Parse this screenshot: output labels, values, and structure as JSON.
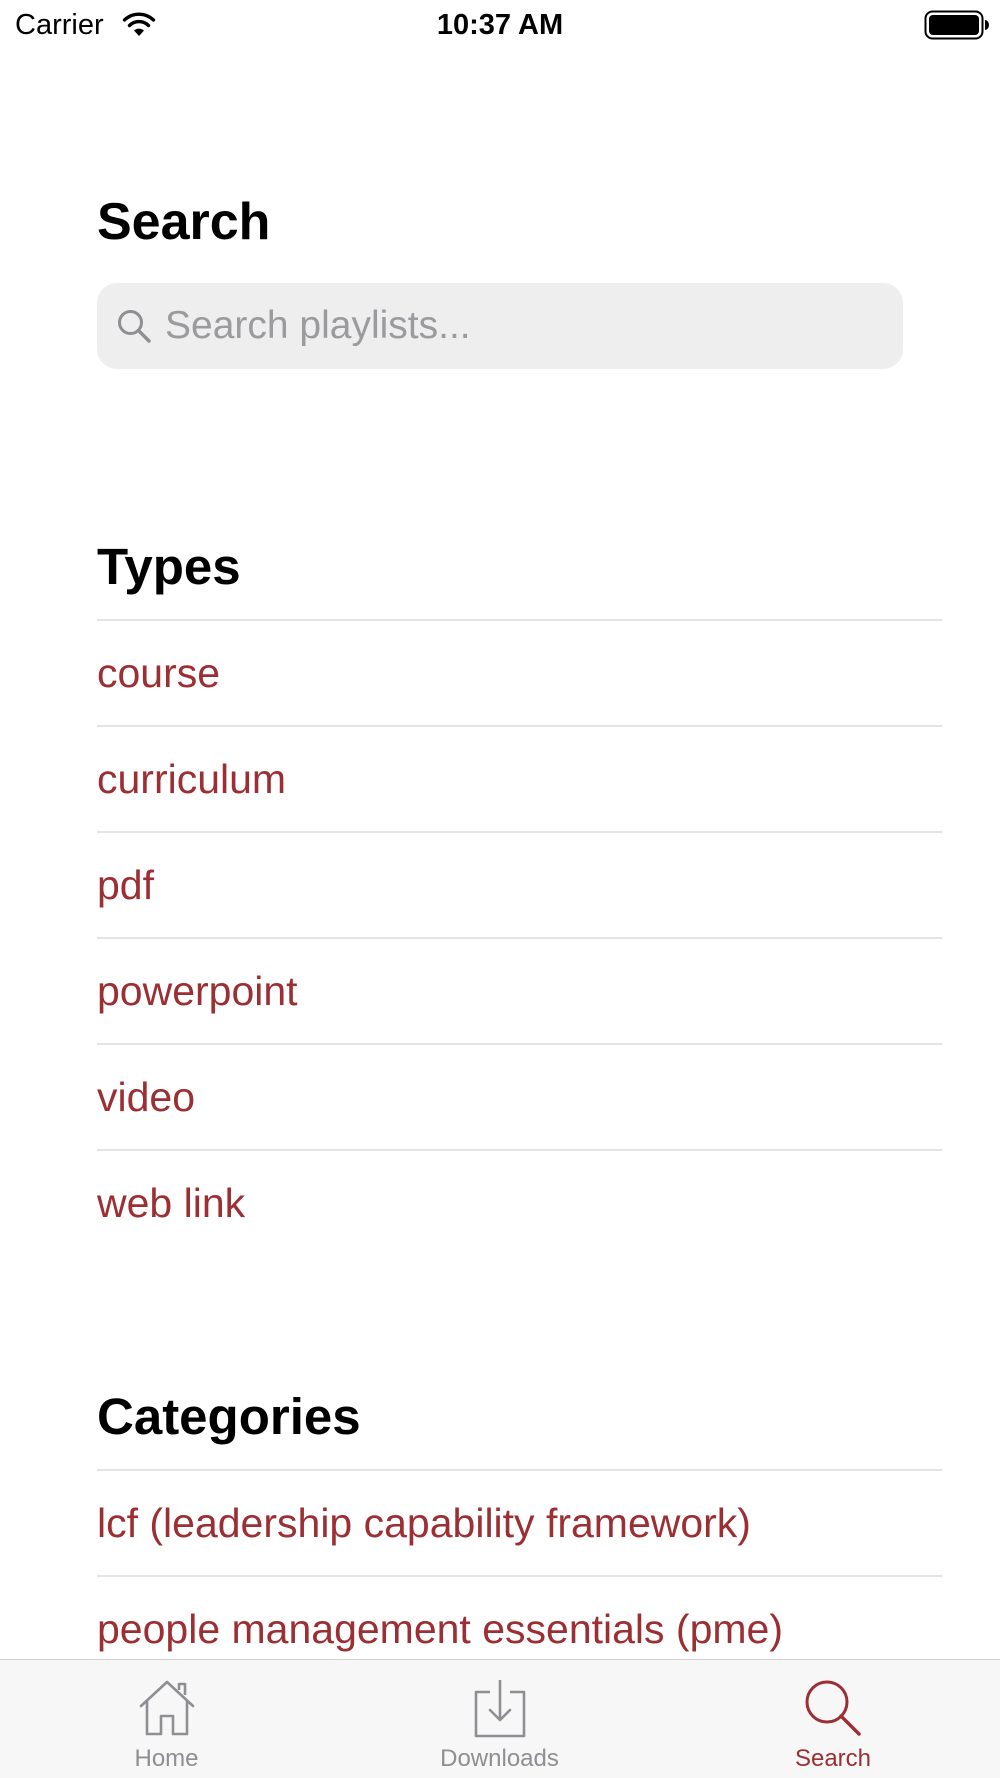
{
  "status_bar": {
    "carrier": "Carrier",
    "time": "10:37 AM"
  },
  "page": {
    "title": "Search"
  },
  "search": {
    "placeholder": "Search playlists...",
    "value": ""
  },
  "types": {
    "heading": "Types",
    "items": [
      "course",
      "curriculum",
      "pdf",
      "powerpoint",
      "video",
      "web link"
    ]
  },
  "categories": {
    "heading": "Categories",
    "items": [
      "lcf (leadership capability framework)",
      "people management essentials (pme)"
    ]
  },
  "tab_bar": {
    "tabs": [
      {
        "label": "Home",
        "icon": "house-icon",
        "selected": false
      },
      {
        "label": "Downloads",
        "icon": "download-tray-icon",
        "selected": false
      },
      {
        "label": "Search",
        "icon": "magnifier-icon",
        "selected": true
      }
    ]
  },
  "colors": {
    "accent": "#9b2f33",
    "inactive_tab": "#8e8e93",
    "search_field_bg": "#eeeeee"
  }
}
